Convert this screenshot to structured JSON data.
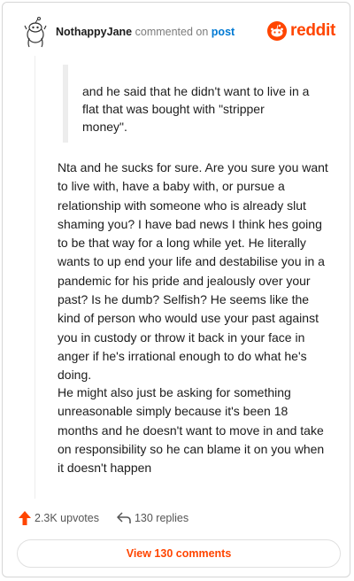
{
  "header": {
    "username": "NothappyJane",
    "commented_on": "commented on",
    "post_link": "post",
    "logo_text": "reddit"
  },
  "quote": {
    "lines": [
      "and he said that he didn't want to live in a",
      "flat that was bought with \"stripper",
      "money\"."
    ]
  },
  "body": {
    "paragraph1_lines": [
      "Nta and he sucks for sure. Are you sure you want",
      "to live with, have a baby with, or pursue a",
      "relationship with someone who is already slut",
      "shaming you? I have bad news I think hes going",
      "to be that way for a long while yet. He literally",
      "wants to up end your life and destabilise you in a",
      "pandemic for his pride and jealously over your",
      "past? Is he dumb? Selfish? He seems like the",
      "kind of person who would use your past against",
      "you in custody or throw it back in your face in",
      "anger if he's irrational enough to do what he's",
      "doing."
    ],
    "paragraph2_lines": [
      "He might also just be asking for something",
      "unreasonable simply because it's been 18",
      "months and he doesn't want to move in and take",
      "on responsibility so he can blame it on you when",
      "it doesn't happen"
    ]
  },
  "footer": {
    "upvotes": "2.3K upvotes",
    "replies": "130 replies",
    "view_comments": "View 130 comments"
  },
  "colors": {
    "accent": "#ff4500",
    "link": "#0079d3",
    "muted": "#7c7c7c"
  },
  "icons": {
    "avatar": "snoo-avatar-icon",
    "logo": "reddit-snoo-icon",
    "upvote": "upvote-arrow-icon",
    "reply": "reply-arrow-icon"
  }
}
